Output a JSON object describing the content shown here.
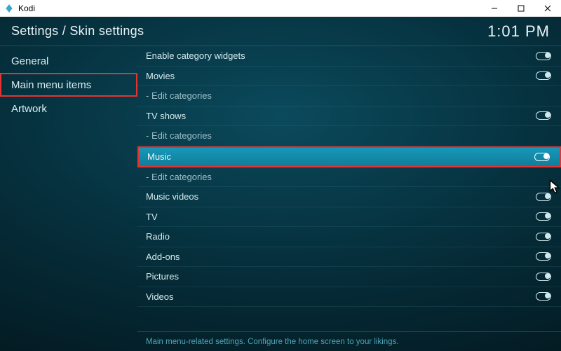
{
  "window": {
    "app_name": "Kodi"
  },
  "header": {
    "breadcrumb": "Settings / Skin settings",
    "time": "1:01 PM"
  },
  "sidebar": {
    "items": [
      {
        "label": "General",
        "selected": false,
        "highlighted": false
      },
      {
        "label": "Main menu items",
        "selected": true,
        "highlighted": true
      },
      {
        "label": "Artwork",
        "selected": false,
        "highlighted": false
      }
    ]
  },
  "settings": [
    {
      "label": "Enable category widgets",
      "type": "toggle",
      "value": true
    },
    {
      "label": "Movies",
      "type": "toggle",
      "value": true
    },
    {
      "label": " - Edit categories",
      "type": "action"
    },
    {
      "label": "TV shows",
      "type": "toggle",
      "value": true
    },
    {
      "label": " - Edit categories",
      "type": "action"
    },
    {
      "label": "Music",
      "type": "toggle",
      "value": true,
      "hover": true
    },
    {
      "label": " - Edit categories",
      "type": "action"
    },
    {
      "label": "Music videos",
      "type": "toggle",
      "value": true
    },
    {
      "label": "TV",
      "type": "toggle",
      "value": true
    },
    {
      "label": "Radio",
      "type": "toggle",
      "value": true
    },
    {
      "label": "Add-ons",
      "type": "toggle",
      "value": true
    },
    {
      "label": "Pictures",
      "type": "toggle",
      "value": true
    },
    {
      "label": "Videos",
      "type": "toggle",
      "value": true
    }
  ],
  "footer": {
    "description": "Main menu-related settings. Configure the home screen to your likings."
  }
}
